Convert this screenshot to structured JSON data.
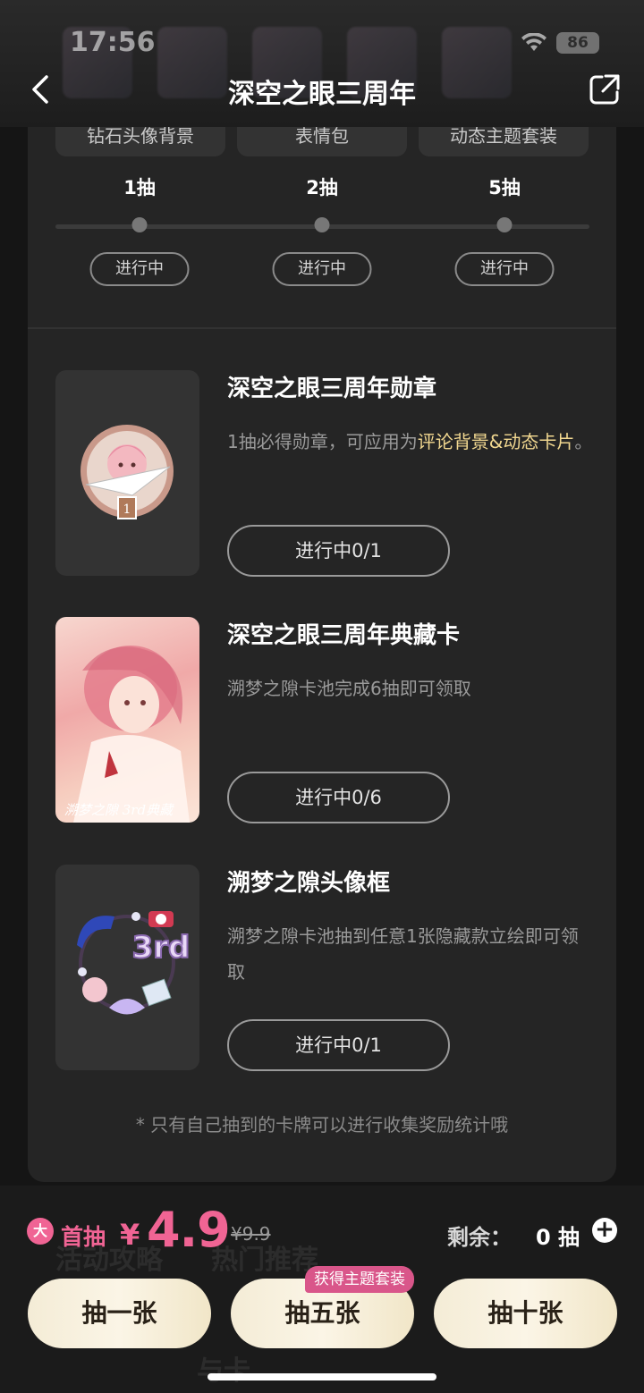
{
  "status_bar": {
    "time": "17:56",
    "battery": "86"
  },
  "nav": {
    "title": "深空之眼三周年"
  },
  "milestones": {
    "tabs": [
      "钻石头像背景",
      "表情包",
      "动态主题套装"
    ],
    "draws": [
      "1抽",
      "2抽",
      "5抽"
    ],
    "status": [
      "进行中",
      "进行中",
      "进行中"
    ]
  },
  "rewards": [
    {
      "title": "深空之眼三周年勋章",
      "desc_plain": "1抽必得勋章，可应用为",
      "desc_highlight": "评论背景&动态卡片",
      "desc_end": "。",
      "button": "进行中0/1",
      "thumb": "medal-icon"
    },
    {
      "title": "深空之眼三周年典藏卡",
      "desc": "溯梦之隙卡池完成6抽即可领取",
      "button": "进行中0/6",
      "thumb": "collection-card",
      "card_text": "溯梦之隙 3rd典藏"
    },
    {
      "title": "溯梦之隙头像框",
      "desc": "溯梦之隙卡池抽到任意1张隐藏款立绘即可领取",
      "button": "进行中0/1",
      "thumb": "avatar-frame-icon",
      "frame_text": "3rd"
    }
  ],
  "footnote": "* 只有自己抽到的卡牌可以进行收集奖励统计哦",
  "purchase": {
    "tag": "大",
    "first_label": "首抽",
    "currency": "¥",
    "price": "4.9",
    "original_price": "¥9.9",
    "remaining_label": "剩余：",
    "remaining_value": "0 抽"
  },
  "buttons": {
    "draw_one": "抽一张",
    "draw_five": "抽五张",
    "draw_ten": "抽十张",
    "five_badge": "获得主题套装"
  },
  "ghost_tabs": [
    "活动攻略",
    "热门推荐",
    "与卡"
  ],
  "colors": {
    "accent": "#f06494",
    "highlight": "#f2d890",
    "panel": "#252525"
  }
}
